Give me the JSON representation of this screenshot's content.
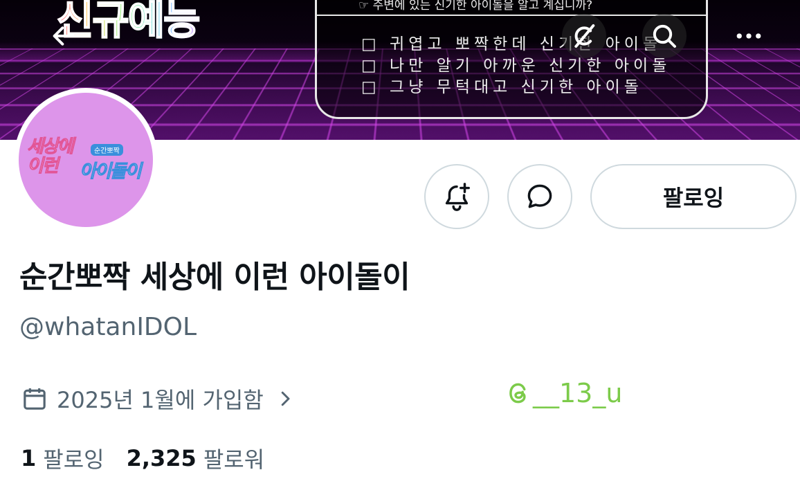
{
  "banner": {
    "logo_text": "신규예능",
    "box_header": "☞ 주변에 있는 신기한 아이돌을 알고 계십니까?",
    "box_lines": [
      "□ 귀엽고 뽀짝한데 신기한 아이돌",
      "□ 나만 알기 아까운 신기한 아이돌",
      "□ 그냥 무턱대고 신기한 아이돌"
    ]
  },
  "nav": {
    "back_icon": "arrow-left-icon",
    "grok_icon": "grok-icon",
    "search_icon": "search-icon",
    "more_icon": "more-dots-icon"
  },
  "avatar": {
    "line1": "세상에",
    "line2": "이런",
    "line3": "아이돌이",
    "tag": "순간뽀짝"
  },
  "actions": {
    "notify_icon": "bell-plus-icon",
    "message_icon": "message-bubble-icon",
    "following_label": "팔로잉"
  },
  "profile": {
    "display_name": "순간뽀짝 세상에 이런 아이돌이",
    "handle": "@whatanIDOL",
    "joined": "2025년 1월에 가입함",
    "joined_icon": "calendar-icon",
    "following_count": "1",
    "following_label": "팔로잉",
    "followers_count": "2,325",
    "followers_label": "팔로워"
  },
  "watermark": {
    "text": "__13_u",
    "icon": "threads-icon",
    "color": "#7ccb4a"
  },
  "colors": {
    "text_primary": "#0f1419",
    "text_secondary": "#536471",
    "border": "#cfd9de",
    "avatar_bg": "#dd95ea"
  }
}
